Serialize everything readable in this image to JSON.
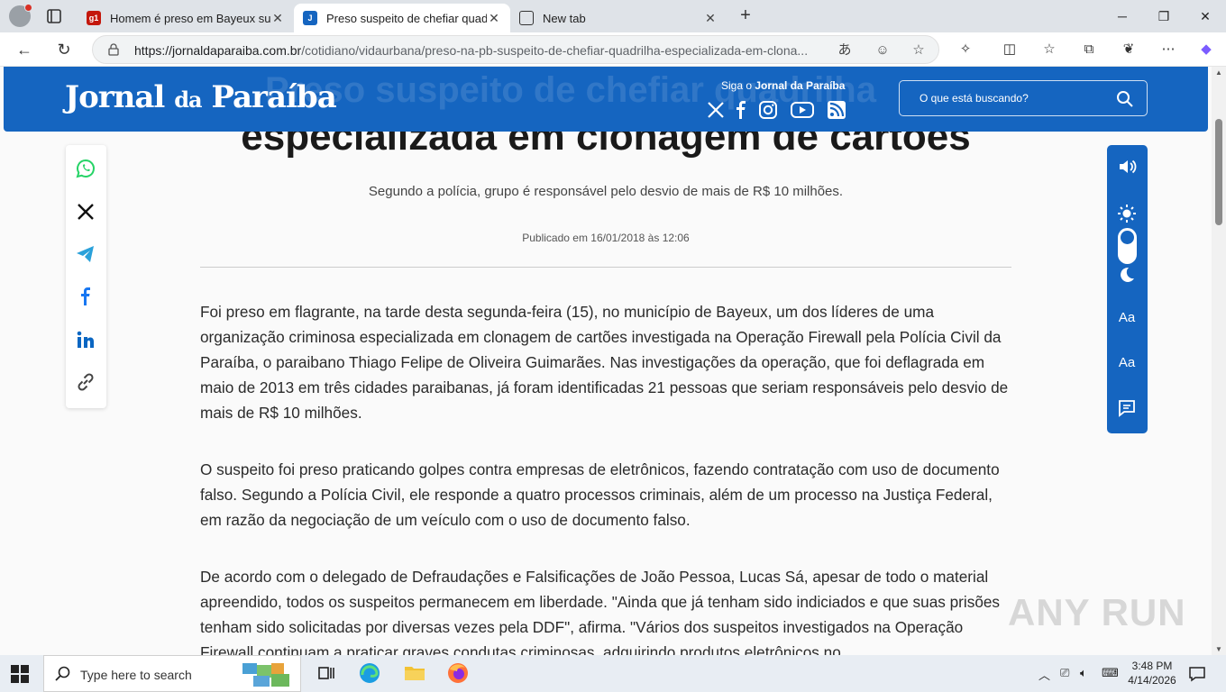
{
  "browser": {
    "tabs": [
      {
        "label": "Homem é preso em Bayeux suspe",
        "favicon": "g1"
      },
      {
        "label": "Preso suspeito de chefiar quadrilh",
        "favicon": "jornal-da-paraiba"
      },
      {
        "label": "New tab",
        "favicon": "newtab"
      }
    ],
    "url_host": "https://jornaldaparaiba.com.br",
    "url_path": "/cotidiano/vidaurbana/preso-na-pb-suspeito-de-chefiar-quadrilha-especializada-em-clona..."
  },
  "site": {
    "logo_main": "Jornal",
    "logo_da": "da",
    "logo_name": "Paraíba",
    "ghost_title": "Preso suspeito de chefiar quadrilha",
    "follow_prefix": "Siga o",
    "follow_brand": "Jornal da Paraíba",
    "search_placeholder": "O que está buscando?"
  },
  "article": {
    "title": "especializada em clonagem de cartões",
    "subtitle": "Segundo a polícia, grupo é responsável pelo desvio de mais de R$ 10 milhões.",
    "published": "Publicado em 16/01/2018 às 12:06",
    "paragraphs": [
      "Foi preso em flagrante, na tarde desta segunda-feira (15), no município de Bayeux, um dos líderes de uma organização criminosa especializada em clonagem de cartões investigada na Operação Firewall pela Polícia Civil da Paraíba, o paraibano Thiago Felipe de Oliveira Guimarães. Nas investigações da operação, que foi deflagrada em maio de 2013 em três cidades paraibanas, já foram identificadas 21 pessoas que seriam responsáveis pelo desvio de mais de R$ 10 milhões.",
      "O suspeito foi preso praticando golpes contra empresas de eletrônicos, fazendo contratação com uso de documento falso. Segundo a Polícia Civil, ele responde a quatro processos criminais, além de um processo na Justiça Federal, em razão da negociação de um veículo com o uso de documento falso.",
      "De acordo com o delegado de Defraudações e Falsificações de João Pessoa, Lucas Sá, apesar de todo o material apreendido, todos os suspeitos permanecem em liberdade. \"Ainda que já tenham sido indiciados e que suas prisões tenham sido solicitadas por diversas vezes pela DDF\", afirma. \"Vários dos suspeitos investigados na Operação Firewall continuam a praticar graves condutas criminosas, adquirindo produtos eletrônicos no"
    ]
  },
  "a11y": {
    "font_increase": "Aa",
    "font_decrease": "Aa"
  },
  "watermark": "ANY RUN",
  "taskbar": {
    "search_placeholder": "Type here to search",
    "time": "3:48 PM",
    "date": "4/14/2026"
  },
  "colors": {
    "brand_blue": "#1565c0",
    "whatsapp": "#25d366",
    "telegram": "#2aa1da",
    "facebook": "#1877f2",
    "linkedin": "#0a66c2"
  }
}
